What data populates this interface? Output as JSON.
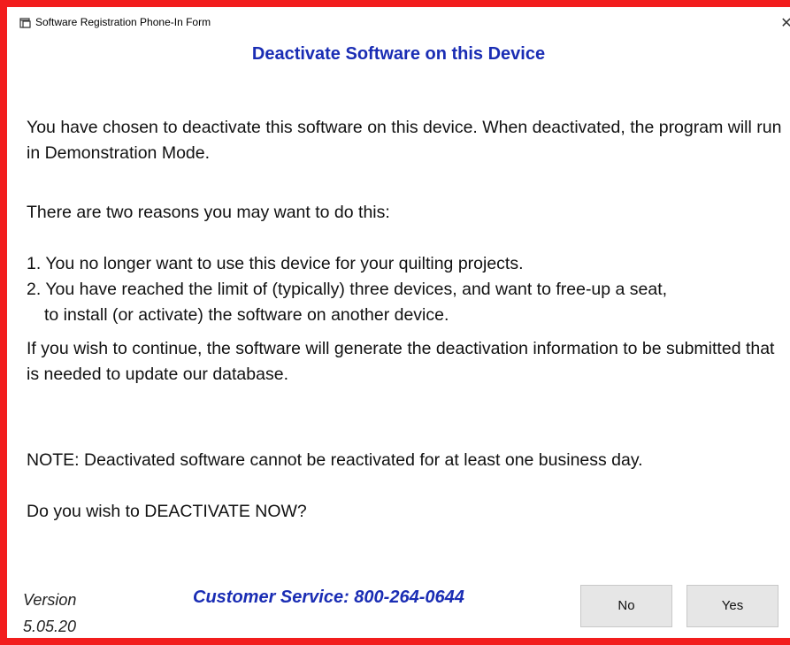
{
  "window": {
    "title": "Software Registration Phone-In Form",
    "close_glyph": "✕"
  },
  "dialog": {
    "heading": "Deactivate Software on this Device",
    "paragraph1": "You have chosen to deactivate this software on this device. When deactivated, the program will run in Demonstration Mode.",
    "paragraph2": "There are two reasons you may want to do this:",
    "reason1": "1. You no longer want to use this device for your quilting projects.",
    "reason2_line1": "2. You have reached the limit of (typically) three devices, and want to free-up a seat,",
    "reason2_line2": "to install (or activate) the software on another device.",
    "paragraph3": "If you wish to continue, the software will generate the deactivation information to be submitted that is needed to update our database.",
    "note": "NOTE:  Deactivated software cannot be reactivated for at least one business day.",
    "question": "Do you wish to DEACTIVATE NOW?"
  },
  "footer": {
    "version_label": "Version",
    "version_number": "5.05.20",
    "customer_service": "Customer Service: 800-264-0644",
    "no_label": "No",
    "yes_label": "Yes"
  },
  "colors": {
    "border": "#f21d1d",
    "accent": "#1a2db4"
  }
}
